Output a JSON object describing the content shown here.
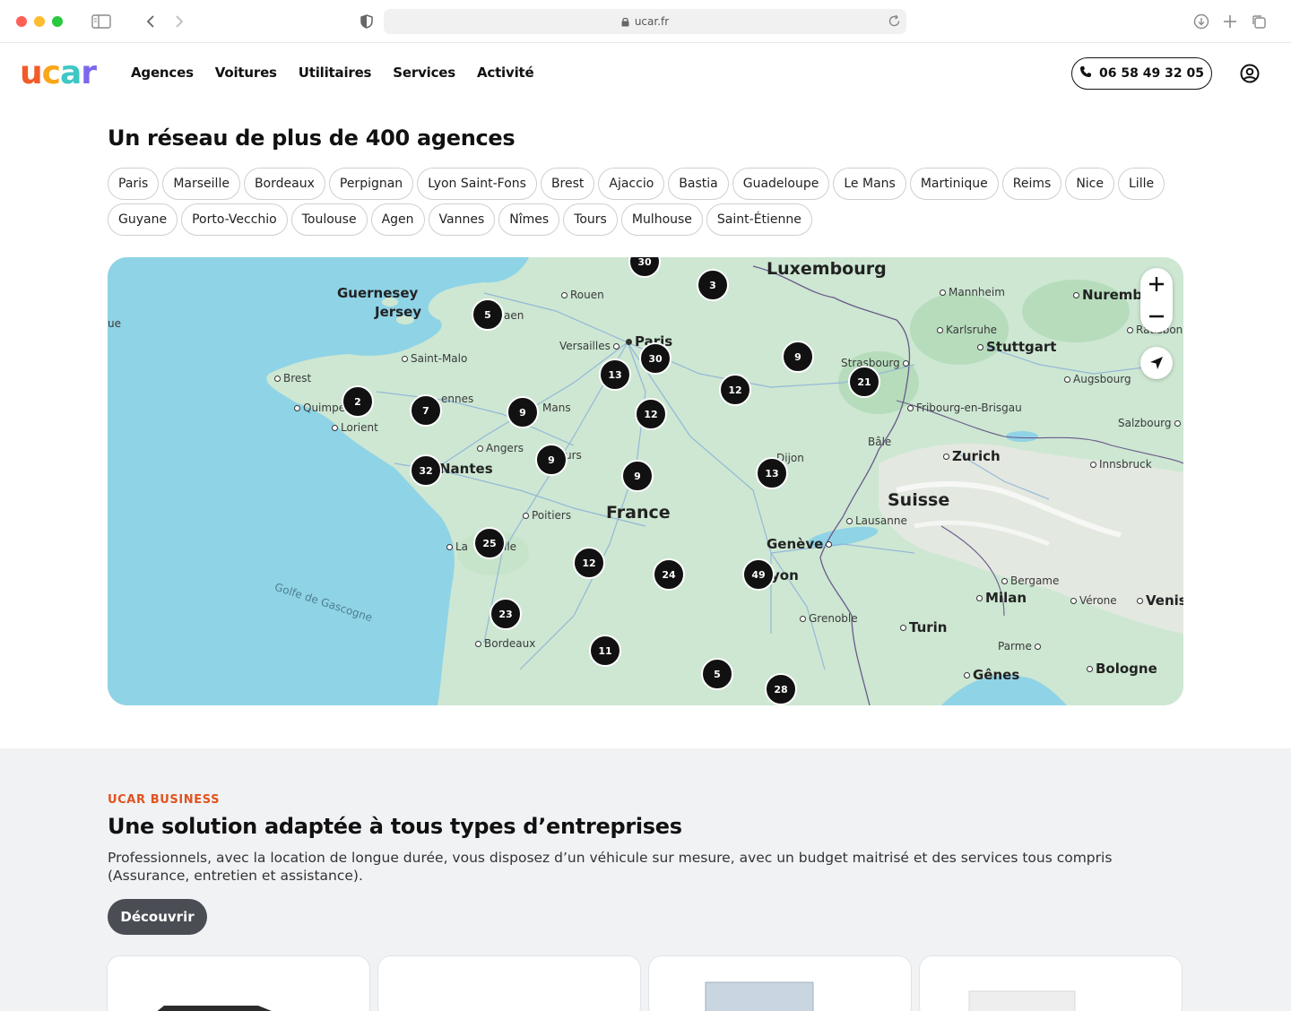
{
  "browser": {
    "url": "ucar.fr"
  },
  "header": {
    "logo": {
      "u": "u",
      "c": "c",
      "a": "a",
      "r": "r"
    },
    "nav": [
      "Agences",
      "Voitures",
      "Utilitaires",
      "Services",
      "Activité"
    ],
    "phone": "06 58 49 32 05"
  },
  "agencies": {
    "title": "Un réseau de plus de 400 agences",
    "chips": [
      "Paris",
      "Marseille",
      "Bordeaux",
      "Perpignan",
      "Lyon Saint-Fons",
      "Brest",
      "Ajaccio",
      "Bastia",
      "Guadeloupe",
      "Le Mans",
      "Martinique",
      "Reims",
      "Nice",
      "Lille",
      "Guyane",
      "Porto-Vecchio",
      "Toulouse",
      "Agen",
      "Vannes",
      "Nîmes",
      "Tours",
      "Mulhouse",
      "Saint-Étienne"
    ]
  },
  "map": {
    "labels": {
      "guernesey": "Guernesey",
      "jersey": "Jersey",
      "rouen": "Rouen",
      "caen": "aen",
      "versailles": "Versailles",
      "paris": "Paris",
      "luxembourg": "Luxembourg",
      "mannheim": "Mannheim",
      "nuremb": "Nuremb",
      "karlsruhe": "Karlsruhe",
      "stuttgart": "Stuttgart",
      "regensburg": "Ratisbon",
      "strasbourg": "Strasbourg",
      "augsbourg": "Augsbourg",
      "fribourg": "Fribourg-en-Brisgau",
      "salzbourg": "Salzbourg",
      "bale": "Bâle",
      "zurich": "Zurich",
      "innsbruck": "Innsbruck",
      "suisse": "Suisse",
      "lausanne": "Lausanne",
      "geneve": "Genève",
      "lyon": "yon",
      "dijon": "Dijon",
      "saintmalo": "Saint-Malo",
      "brest": "Brest",
      "quimper": "Quimpe",
      "lorient": "Lorient",
      "rennes": "ennes",
      "lemans": "Mans",
      "angers": "Angers",
      "tours": "urs",
      "nantes": "Nantes",
      "france": "France",
      "poitiers": "Poitiers",
      "larochelle_a": "La",
      "larochelle_b": "lle",
      "gascogne": "Golfe de Gascogne",
      "bordeaux": "Bordeaux",
      "grenoble": "Grenoble",
      "turin": "Turin",
      "bergame": "Bergame",
      "milan": "Milan",
      "verone": "Vérone",
      "venise": "Venis",
      "parme": "Parme",
      "genes": "Gênes",
      "bologne": "Bologne",
      "ue": "ue"
    },
    "clusters": [
      "30",
      "3",
      "5",
      "9",
      "30",
      "13",
      "12",
      "21",
      "2",
      "7",
      "9",
      "12",
      "32",
      "9",
      "9",
      "13",
      "25",
      "12",
      "24",
      "49",
      "23",
      "11",
      "5",
      "28"
    ]
  },
  "business": {
    "kicker": "UCAR BUSINESS",
    "title": "Une solution adaptée à tous types d’entreprises",
    "text": "Professionnels, avec la location de longue durée, vous disposez d’un véhicule sur mesure, avec un budget maitrisé et des services tous compris (Assurance, entretien et assistance).",
    "button": "Découvrir"
  },
  "colors": {
    "brand_orange": "#e0531f",
    "logo_u": "#f25c2a",
    "logo_c": "#f9a61a",
    "logo_a": "#3ec7c5",
    "logo_r": "#7b68ee",
    "map_land": "#cde7d2",
    "map_sea": "#8fd3e6",
    "cluster": "#111111"
  }
}
